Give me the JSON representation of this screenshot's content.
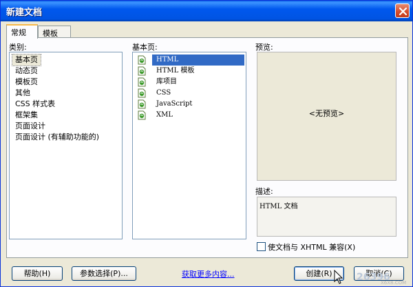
{
  "window": {
    "title": "新建文档",
    "close_icon": "close-icon"
  },
  "tabs": [
    {
      "label": "常规",
      "active": true
    },
    {
      "label": "模板",
      "active": false
    }
  ],
  "category": {
    "label": "类别:",
    "items": [
      "基本页",
      "动态页",
      "模板页",
      "其他",
      "CSS 样式表",
      "框架集",
      "页面设计",
      "页面设计 (有辅助功能的)"
    ],
    "selected_index": 0
  },
  "basic_page": {
    "label": "基本页:",
    "items": [
      "HTML",
      "HTML 模板",
      "库项目",
      "CSS",
      "JavaScript",
      "XML"
    ],
    "selected_index": 0,
    "item_icon": "document-icon"
  },
  "preview": {
    "label": "预览:",
    "placeholder": "<无预览>"
  },
  "description": {
    "label": "描述:",
    "text": "HTML 文档"
  },
  "xhtml_checkbox": {
    "label": "使文档与 XHTML 兼容(X)",
    "checked": false
  },
  "footer": {
    "help": "帮助(H)",
    "preferences": "参数选择(P)...",
    "more_content": "获取更多内容...",
    "create": "创建(R)",
    "cancel": "取消(C)"
  },
  "watermark": {
    "logo": "26396",
    "site": "X6X8.COM"
  }
}
